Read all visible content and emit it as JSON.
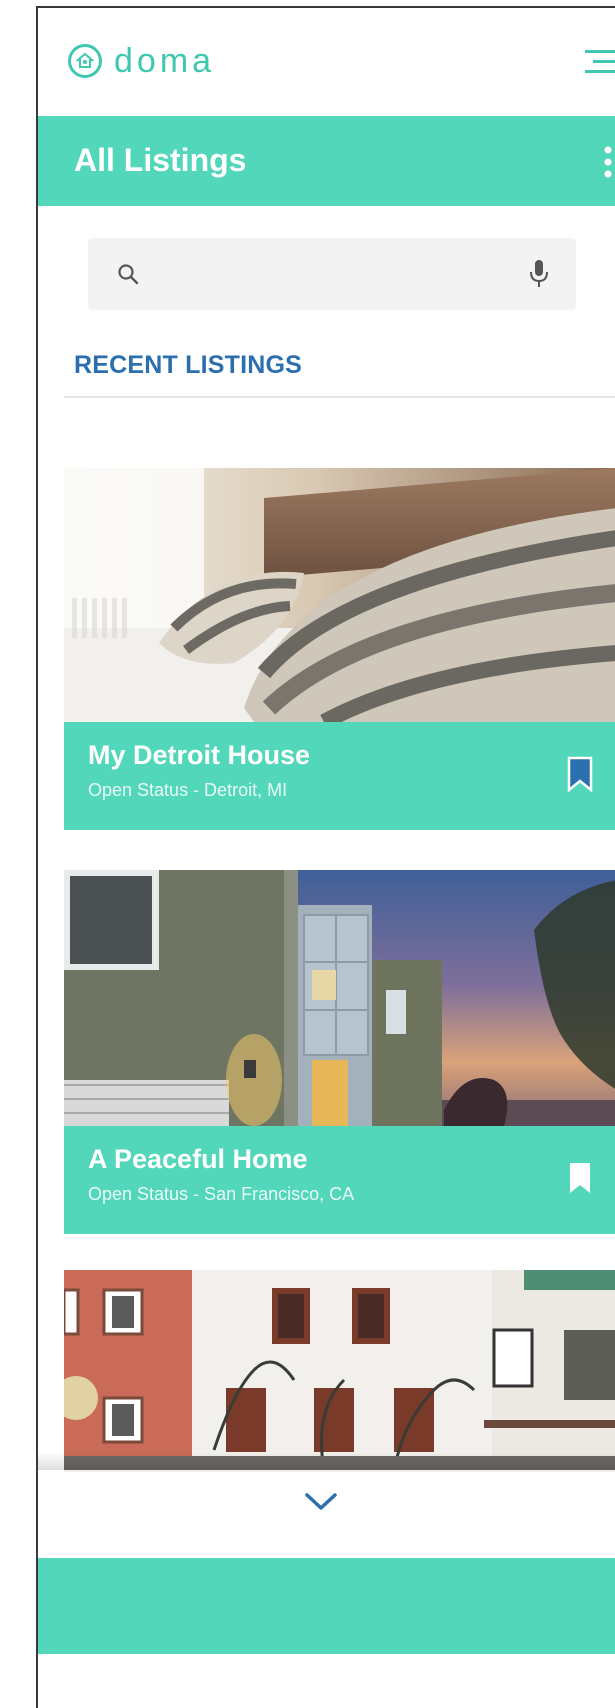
{
  "brand": {
    "name": "doma",
    "color": "#3fc7b0",
    "icon": "house-circle-icon"
  },
  "header": {
    "menu_icon": "hamburger-icon"
  },
  "appbar": {
    "title": "All Listings",
    "accent": "#52d7bb",
    "overflow_icon": "vertical-dots-icon"
  },
  "search": {
    "value": "",
    "placeholder": "",
    "icon": "search-icon",
    "voice_icon": "microphone-icon"
  },
  "section": {
    "title": "RECENT LISTINGS",
    "color": "#2b6fae"
  },
  "listings": [
    {
      "title": "My Detroit House",
      "subtitle": "Open Status - Detroit, MI",
      "bookmark": "filled",
      "bookmark_color": "#2b6fae"
    },
    {
      "title": "A Peaceful Home",
      "subtitle": "Open Status - San Francisco, CA",
      "bookmark": "filled",
      "bookmark_color": "#ffffff"
    }
  ],
  "footer": {
    "expand_icon": "chevron-down-icon"
  }
}
